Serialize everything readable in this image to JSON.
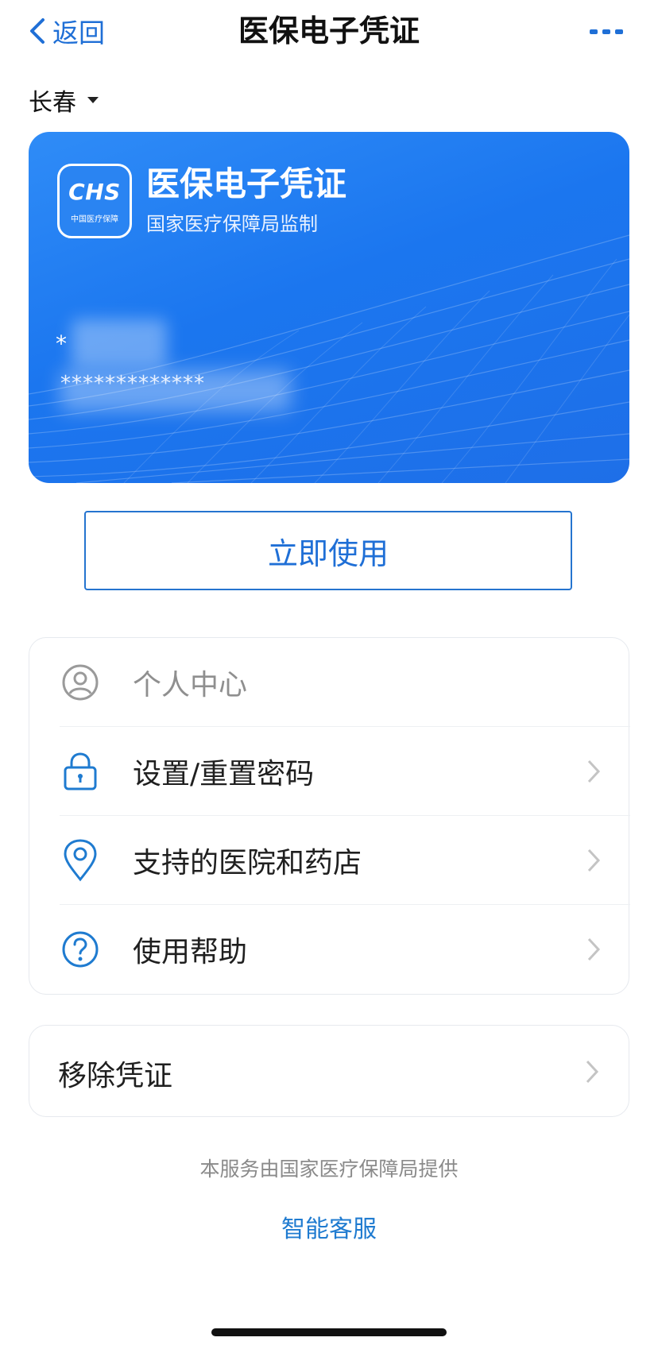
{
  "nav": {
    "back_label": "返回",
    "title": "医保电子凭证",
    "more_icon": "more-dots-icon"
  },
  "city": {
    "name": "长春"
  },
  "card": {
    "logo_text": "CHS",
    "logo_subtext": "中国医疗保障",
    "title": "医保电子凭证",
    "subtitle": "国家医疗保障局监制",
    "name_masked": "*",
    "number_masked": "*************"
  },
  "use_button": {
    "label": "立即使用"
  },
  "menu": {
    "items": [
      {
        "label": "个人中心",
        "icon": "user-circle-icon"
      },
      {
        "label": "设置/重置密码",
        "icon": "lock-icon"
      },
      {
        "label": "支持的医院和药店",
        "icon": "location-pin-icon"
      },
      {
        "label": "使用帮助",
        "icon": "help-circle-icon"
      }
    ]
  },
  "remove": {
    "label": "移除凭证"
  },
  "footer": {
    "note": "本服务由国家医疗保障局提供",
    "service_link": "智能客服"
  },
  "colors": {
    "accent": "#1f6fd6",
    "card_blue": "#1e76ef"
  }
}
